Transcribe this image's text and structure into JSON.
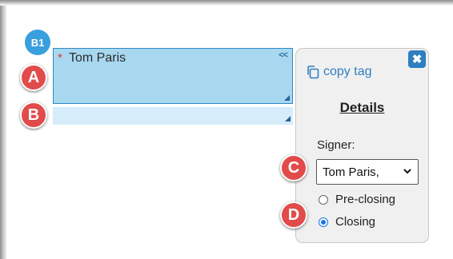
{
  "field_badge": "B1",
  "field_a": {
    "required_mark": "*",
    "signer_name": "Tom Paris",
    "collapse_label": "<<"
  },
  "callouts": {
    "a": "A",
    "b": "B",
    "c": "C",
    "d": "D"
  },
  "popover": {
    "close_symbol": "✖",
    "copy_tag_label": "copy tag",
    "details_heading": "Details",
    "signer_label": "Signer:",
    "signer_selected": "Tom Paris,",
    "radio_options": [
      {
        "label": "Pre-closing",
        "checked": false
      },
      {
        "label": "Closing",
        "checked": true
      }
    ]
  },
  "icons": {
    "copy": "copy-icon",
    "close": "close-icon",
    "chevron": "chevron-down-icon",
    "resize": "resize-handle-icon"
  },
  "colors": {
    "field_fill": "#a8d8f0",
    "field_border": "#2f88c8",
    "callout_red": "#e24b4b",
    "badge_blue": "#3a9fde",
    "link_blue": "#2f7fc4",
    "close_blue": "#2d7fc1"
  }
}
